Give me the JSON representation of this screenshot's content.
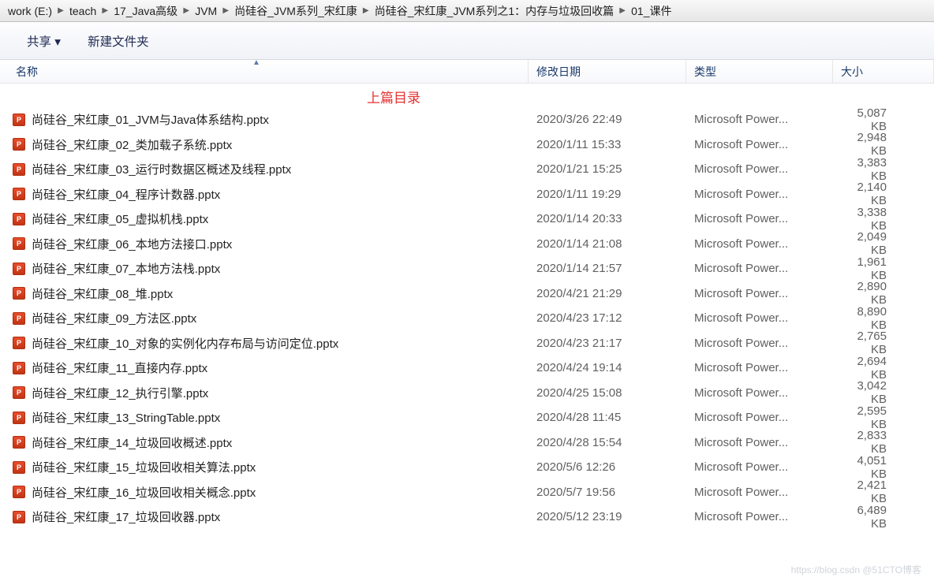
{
  "breadcrumb": {
    "segs": [
      "work (E:)",
      "teach",
      "17_Java高级",
      "JVM",
      "尚硅谷_JVM系列_宋红康",
      "尚硅谷_宋红康_JVM系列之1：内存与垃圾回收篇",
      "01_课件"
    ]
  },
  "toolbar": {
    "share": "共享 ▾",
    "new_folder": "新建文件夹"
  },
  "columns": {
    "name": "名称",
    "date": "修改日期",
    "type": "类型",
    "size": "大小"
  },
  "annotation": "上篇目录",
  "files": [
    {
      "name": "尚硅谷_宋红康_01_JVM与Java体系结构.pptx",
      "date": "2020/3/26 22:49",
      "type": "Microsoft Power...",
      "size": "5,087 KB"
    },
    {
      "name": "尚硅谷_宋红康_02_类加载子系统.pptx",
      "date": "2020/1/11 15:33",
      "type": "Microsoft Power...",
      "size": "2,948 KB"
    },
    {
      "name": "尚硅谷_宋红康_03_运行时数据区概述及线程.pptx",
      "date": "2020/1/21 15:25",
      "type": "Microsoft Power...",
      "size": "3,383 KB"
    },
    {
      "name": "尚硅谷_宋红康_04_程序计数器.pptx",
      "date": "2020/1/11 19:29",
      "type": "Microsoft Power...",
      "size": "2,140 KB"
    },
    {
      "name": "尚硅谷_宋红康_05_虚拟机栈.pptx",
      "date": "2020/1/14 20:33",
      "type": "Microsoft Power...",
      "size": "3,338 KB"
    },
    {
      "name": "尚硅谷_宋红康_06_本地方法接口.pptx",
      "date": "2020/1/14 21:08",
      "type": "Microsoft Power...",
      "size": "2,049 KB"
    },
    {
      "name": "尚硅谷_宋红康_07_本地方法栈.pptx",
      "date": "2020/1/14 21:57",
      "type": "Microsoft Power...",
      "size": "1,961 KB"
    },
    {
      "name": "尚硅谷_宋红康_08_堆.pptx",
      "date": "2020/4/21 21:29",
      "type": "Microsoft Power...",
      "size": "2,890 KB"
    },
    {
      "name": "尚硅谷_宋红康_09_方法区.pptx",
      "date": "2020/4/23 17:12",
      "type": "Microsoft Power...",
      "size": "8,890 KB"
    },
    {
      "name": "尚硅谷_宋红康_10_对象的实例化内存布局与访问定位.pptx",
      "date": "2020/4/23 21:17",
      "type": "Microsoft Power...",
      "size": "2,765 KB"
    },
    {
      "name": "尚硅谷_宋红康_11_直接内存.pptx",
      "date": "2020/4/24 19:14",
      "type": "Microsoft Power...",
      "size": "2,694 KB"
    },
    {
      "name": "尚硅谷_宋红康_12_执行引擎.pptx",
      "date": "2020/4/25 15:08",
      "type": "Microsoft Power...",
      "size": "3,042 KB"
    },
    {
      "name": "尚硅谷_宋红康_13_StringTable.pptx",
      "date": "2020/4/28 11:45",
      "type": "Microsoft Power...",
      "size": "2,595 KB"
    },
    {
      "name": "尚硅谷_宋红康_14_垃圾回收概述.pptx",
      "date": "2020/4/28 15:54",
      "type": "Microsoft Power...",
      "size": "2,833 KB"
    },
    {
      "name": "尚硅谷_宋红康_15_垃圾回收相关算法.pptx",
      "date": "2020/5/6 12:26",
      "type": "Microsoft Power...",
      "size": "4,051 KB"
    },
    {
      "name": "尚硅谷_宋红康_16_垃圾回收相关概念.pptx",
      "date": "2020/5/7 19:56",
      "type": "Microsoft Power...",
      "size": "2,421 KB"
    },
    {
      "name": "尚硅谷_宋红康_17_垃圾回收器.pptx",
      "date": "2020/5/12 23:19",
      "type": "Microsoft Power...",
      "size": "6,489 KB"
    }
  ],
  "watermark": "https://blog.csdn   @51CTO博客"
}
